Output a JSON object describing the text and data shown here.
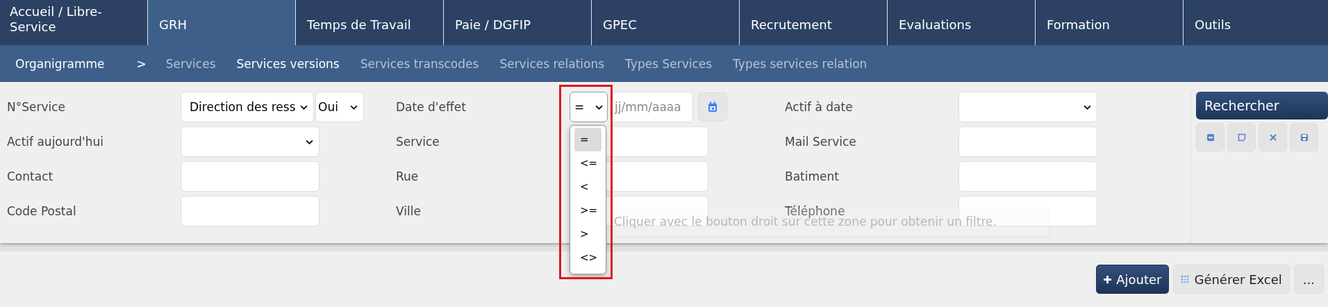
{
  "nav": {
    "tabs": [
      {
        "label": "Accueil / Libre-Service",
        "selected": false
      },
      {
        "label": "GRH",
        "selected": true
      },
      {
        "label": "Temps de Travail",
        "selected": false
      },
      {
        "label": "Paie / DGFIP",
        "selected": false
      },
      {
        "label": "GPEC",
        "selected": false
      },
      {
        "label": "Recrutement",
        "selected": false
      },
      {
        "label": "Evaluations",
        "selected": false
      },
      {
        "label": "Formation",
        "selected": false
      },
      {
        "label": "Outils",
        "selected": false
      }
    ]
  },
  "subnav": {
    "title": "Organigramme",
    "separator": ">",
    "items": [
      {
        "label": "Services",
        "selected": false
      },
      {
        "label": "Services versions",
        "selected": true
      },
      {
        "label": "Services transcodes",
        "selected": false
      },
      {
        "label": "Services relations",
        "selected": false
      },
      {
        "label": "Types Services",
        "selected": false
      },
      {
        "label": "Types services relation",
        "selected": false
      }
    ]
  },
  "filters": {
    "rows": [
      [
        {
          "label": "N°Service",
          "kind": "select_pair",
          "value": "Direction des ress",
          "extra": "Oui"
        },
        {
          "label": "Date d'effet",
          "kind": "date",
          "operator": "=",
          "placeholder": "jj/mm/aaaa",
          "options": [
            {
              "label": "=",
              "selected": true
            },
            {
              "label": "<=",
              "selected": false
            },
            {
              "label": "<",
              "selected": false
            },
            {
              "label": ">=",
              "selected": false
            },
            {
              "label": ">",
              "selected": false
            },
            {
              "label": "<>",
              "selected": false
            }
          ]
        },
        {
          "label": "Actif à date",
          "kind": "select"
        }
      ],
      [
        {
          "label": "Actif aujourd'hui",
          "kind": "select"
        },
        {
          "label": "Service",
          "kind": "text"
        },
        {
          "label": "Mail Service",
          "kind": "text"
        }
      ],
      [
        {
          "label": "Contact",
          "kind": "text"
        },
        {
          "label": "Rue",
          "kind": "text"
        },
        {
          "label": "Batiment",
          "kind": "text"
        }
      ],
      [
        {
          "label": "Code Postal",
          "kind": "text"
        },
        {
          "label": "Ville",
          "kind": "text"
        },
        {
          "label": "Téléphone",
          "kind": "text"
        }
      ]
    ],
    "search_button": "Rechercher",
    "tooltip": "Cliquer avec le bouton droit sur cette zone pour obtenir un filtre."
  },
  "actions": [
    {
      "label": "Ajouter",
      "kind": "primary"
    },
    {
      "label": "Générer Excel",
      "kind": "excel"
    },
    {
      "label": "...",
      "kind": "more"
    }
  ]
}
